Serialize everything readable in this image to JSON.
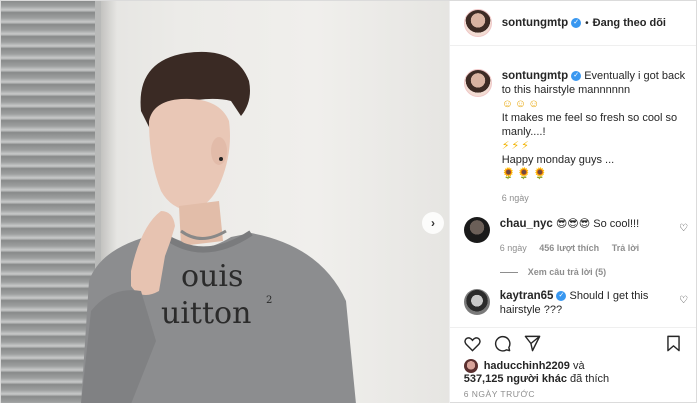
{
  "post": {
    "author": "sontungmtp",
    "follow_dot": "•",
    "follow_status": "Đang theo dõi"
  },
  "caption": {
    "username": "sontungmtp",
    "line1": "Eventually i got back",
    "line2": "to this hairstyle mannnnnn",
    "emoji1": "☺☺☺",
    "line3": "It makes me feel so fresh so cool so",
    "line4": "manly....!",
    "emoji2": "⚡⚡⚡",
    "line5": "Happy monday guys ...",
    "emoji3": "🌻🌻🌻",
    "time": "6 ngày"
  },
  "comments": [
    {
      "username": "chau_nyc",
      "text": "😎😎😎 So cool!!!",
      "time": "6 ngày",
      "likes": "456 lượt thích",
      "reply": "Trả lời",
      "view_replies": "Xem câu trả lời (5)"
    },
    {
      "username": "kaytran65",
      "text": "Should I get this hairstyle ???"
    }
  ],
  "likes": {
    "first_liker": "haducchinh2209",
    "and": "và",
    "others": "537,125 người khác",
    "suffix": "đã thích"
  },
  "timestamp": "6 NGÀY TRƯỚC",
  "next_arrow": "›",
  "verified_mark": "✓",
  "heart_small": "♡"
}
